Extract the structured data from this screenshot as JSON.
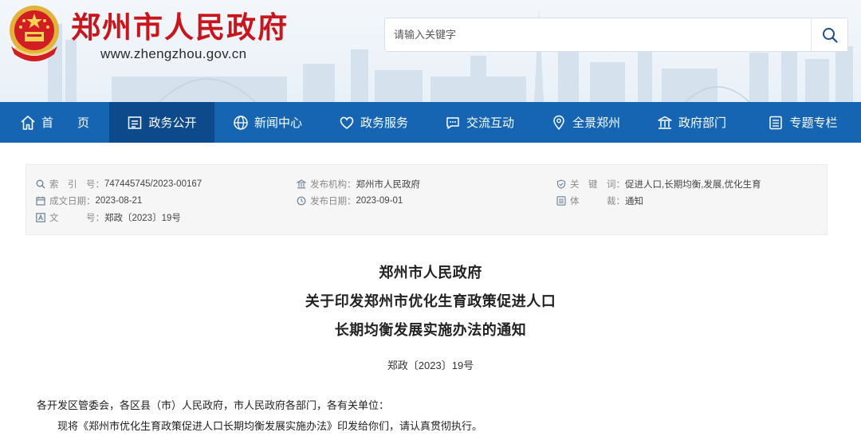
{
  "header": {
    "site_title": "郑州市人民政府",
    "site_url": "www.zhengzhou.gov.cn",
    "search_placeholder": "请输入关键字"
  },
  "nav": {
    "items": [
      {
        "label": "首　　页",
        "icon": "home-icon",
        "active": false
      },
      {
        "label": "政务公开",
        "icon": "document-icon",
        "active": true
      },
      {
        "label": "新闻中心",
        "icon": "globe-icon",
        "active": false
      },
      {
        "label": "政务服务",
        "icon": "heart-icon",
        "active": false
      },
      {
        "label": "交流互动",
        "icon": "chat-icon",
        "active": false
      },
      {
        "label": "全景郑州",
        "icon": "location-icon",
        "active": false
      },
      {
        "label": "政府部门",
        "icon": "building-icon",
        "active": false
      },
      {
        "label": "专题专栏",
        "icon": "list-icon",
        "active": false
      }
    ]
  },
  "meta": {
    "index_label": "索　引　号：",
    "index_value": "747445745/2023-00167",
    "publisher_label": "发布机构：",
    "publisher_value": "郑州市人民政府",
    "keywords_label": "关　键　词：",
    "keywords_value": "促进人口,长期均衡,发展,优化生育",
    "created_label": "成文日期：",
    "created_value": "2023-08-21",
    "published_label": "发布日期：",
    "published_value": "2023-09-01",
    "genre_label": "体　　　裁：",
    "genre_value": "通知",
    "docno_label": "文　　　号：",
    "docno_value": "郑政〔2023〕19号"
  },
  "document": {
    "title_line1": "郑州市人民政府",
    "title_line2": "关于印发郑州市优化生育政策促进人口",
    "title_line3": "长期均衡发展实施办法的通知",
    "number": "郑政〔2023〕19号",
    "salutation": "各开发区管委会，各区县（市）人民政府，市人民政府各部门，各有关单位：",
    "body_line1": "现将《郑州市优化生育政策促进人口长期均衡发展实施办法》印发给你们，请认真贯彻执行。"
  },
  "colors": {
    "brand_red": "#c8161d",
    "nav_blue": "#1565b3",
    "nav_active": "#0d4a8c"
  }
}
